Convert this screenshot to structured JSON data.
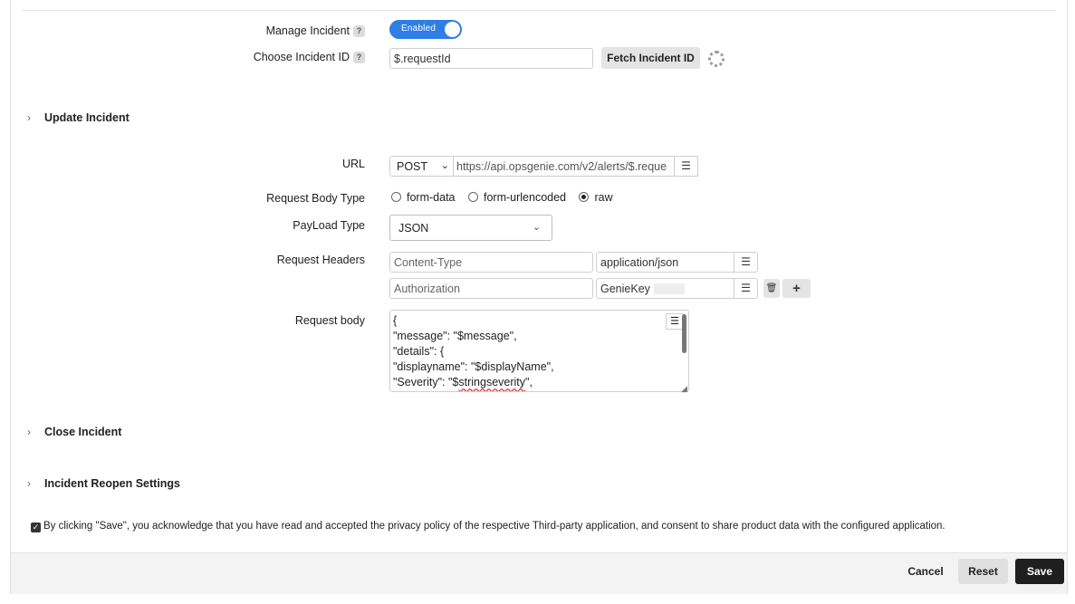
{
  "manage_incident": {
    "label": "Manage Incident",
    "help": "?",
    "toggle_text": "Enabled",
    "enabled": true
  },
  "choose_incident": {
    "label": "Choose Incident ID",
    "help": "?",
    "value": "$.requestId",
    "fetch_button": "Fetch Incident ID"
  },
  "sections": {
    "update": "Update Incident",
    "close": "Close Incident",
    "reopen": "Incident Reopen Settings"
  },
  "url": {
    "label": "URL",
    "method": "POST",
    "value": "https://api.opsgenie.com/v2/alerts/$.reque"
  },
  "body_type": {
    "label": "Request Body Type",
    "options": [
      "form-data",
      "form-urlencoded",
      "raw"
    ],
    "selected": "raw"
  },
  "payload": {
    "label": "PayLoad Type",
    "value": "JSON"
  },
  "headers": {
    "label": "Request Headers",
    "rows": [
      {
        "key": "Content-Type",
        "value": "application/json"
      },
      {
        "key": "Authorization",
        "value": "GenieKey"
      }
    ]
  },
  "request_body": {
    "label": "Request body",
    "lines": [
      "{",
      "\"message\": \"$message\",",
      "\"details\": {",
      "\"displayname\": \"$displayName\",",
      "\"Severity\": \"$stringseverity\","
    ]
  },
  "consent": {
    "checked": true,
    "text": "By clicking \"Save\", you acknowledge that you have read and accepted the privacy policy of the respective Third-party application, and consent to share product data with the configured application."
  },
  "footer": {
    "cancel": "Cancel",
    "reset": "Reset",
    "save": "Save"
  },
  "colors": {
    "accent": "#2f7ee6",
    "save_bg": "#1f1f1f"
  }
}
